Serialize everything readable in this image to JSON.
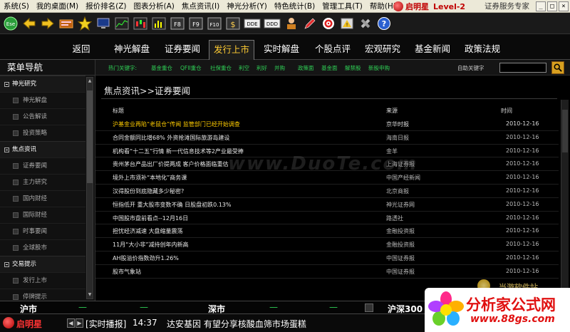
{
  "menubar": {
    "items": [
      "系统(S)",
      "我的桌面(M)",
      "报价排名(Z)",
      "图表分析(A)",
      "焦点资讯(I)",
      "神光分析(Y)",
      "特色统计(B)",
      "管理工具(T)",
      "帮助(H)"
    ],
    "brand_name": "启明星",
    "brand_level": "Level-2",
    "service": "证券服务专家",
    "win_controls": [
      "_",
      "□",
      "×"
    ]
  },
  "toolbar": {
    "icons": [
      "ese-logo-icon",
      "back-arrow-icon",
      "forward-arrow-icon",
      "keyboard-icon",
      "star-icon",
      "monitor-icon",
      "chart-icon",
      "candlestick-icon",
      "bar-chart-icon",
      "f8-icon",
      "f9-icon",
      "f10-icon",
      "finance-icon",
      "ddx-icon",
      "ddy-icon",
      "person-icon",
      "pencil-icon",
      "target-icon",
      "warning-icon",
      "tools-icon",
      "help-icon"
    ],
    "labels": {
      "f8": "F8",
      "f9": "F9",
      "f10": "F10",
      "ddx": "DDE",
      "ddy": "DDD"
    }
  },
  "navtabs": [
    "返回",
    "神光解盘",
    "证券要闻",
    "发行上市",
    "实时解盘",
    "个股点评",
    "宏观研究",
    "基金新闻",
    "政策法规"
  ],
  "active_tab": "发行上市",
  "sidebar": {
    "title": "菜单导航",
    "groups": [
      {
        "label": "神光研究",
        "items": [
          "神光解盘",
          "公告解读",
          "投资策略"
        ]
      },
      {
        "label": "焦点资讯",
        "items": [
          "证券要闻",
          "主力研究",
          "国内财经",
          "国际财经",
          "时事要闻",
          "全球股市"
        ]
      },
      {
        "label": "交易提示",
        "items": [
          "发行上市",
          "停牌提示"
        ]
      }
    ]
  },
  "keywords": {
    "label": "热门关键字:",
    "items": [
      "基金重仓",
      "QFII重仓",
      "社保重仓",
      "利空",
      "利好",
      "并购",
      "政策面",
      "基金面",
      "解禁股",
      "新股申购"
    ],
    "auto_label": "自助关键字",
    "input_value": ""
  },
  "breadcrumb": "焦点资讯>>证券要闻",
  "news": {
    "headers": {
      "title": "标题",
      "source": "来源",
      "time": "时间"
    },
    "rows": [
      {
        "title": "沪基金业再陷“老鼠仓”传闻 监管部门已经开始调查",
        "source": "京华时报",
        "time": "2010-12-16",
        "highlight": true
      },
      {
        "title": "合同金额同比增68% 外资抢滩国际旅游岛建设",
        "source": "海南日报",
        "time": "2010-12-16",
        "highlight": false
      },
      {
        "title": "机构看“十二五”行情 新一代信息技术等2产业最受捧",
        "source": "金羊",
        "time": "2010-12-16",
        "highlight": false
      },
      {
        "title": "贵州茅台产品出厂价提两成 客户价格面临重估",
        "source": "上海证券报",
        "time": "2010-12-16",
        "highlight": false
      },
      {
        "title": "境外上市须补“本地化”商务课",
        "source": "中国产经新闻",
        "time": "2010-12-16",
        "highlight": false
      },
      {
        "title": "汉得股份到底隐藏多少秘密?",
        "source": "北京商报",
        "time": "2010-12-16",
        "highlight": false
      },
      {
        "title": "恒指低开 重大股市变数不确 日股盘初跌0.13%",
        "source": "神光证券网",
        "time": "2010-12-16",
        "highlight": false
      },
      {
        "title": "中国股市盘前看点--12月16日",
        "source": "路透社",
        "time": "2010-12-16",
        "highlight": false
      },
      {
        "title": "担忧经济减速 大盘缩量震荡",
        "source": "金融投资报",
        "time": "2010-12-16",
        "highlight": false
      },
      {
        "title": "11月“大小非”减持创年内新高",
        "source": "金融投资报",
        "time": "2010-12-16",
        "highlight": false
      },
      {
        "title": "AH股溢价指数劲升1.26%",
        "source": "中国证券报",
        "time": "2010-12-16",
        "highlight": false
      },
      {
        "title": "股市气象站",
        "source": "中国证券报",
        "time": "2010-12-16",
        "highlight": false
      }
    ]
  },
  "watermark": "www.DuoTe.com",
  "marketbar": {
    "sh": "沪市",
    "sz": "深市",
    "hs300": "沪深300",
    "dash": "—"
  },
  "statusbar": {
    "brand": "启明星",
    "broadcast": "[实时播报]",
    "time": "14:37",
    "ticker": "达安基因 有望分享核酸血筛市场蛋糕"
  },
  "overlay": {
    "title": "分析家公式网",
    "url": "www.88gs.com",
    "badge": "当游软件站"
  }
}
